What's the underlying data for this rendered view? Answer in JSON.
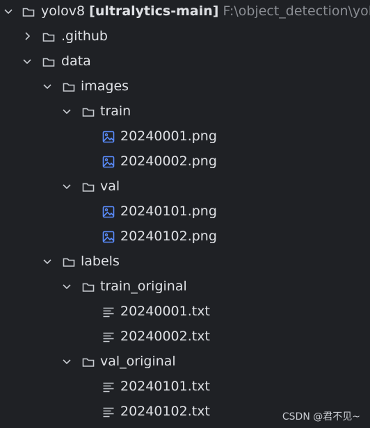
{
  "tree": {
    "root": {
      "name": "yolov8",
      "project": "[ultralytics-main]",
      "path": "F:\\object_detection\\yolo"
    },
    "items": [
      {
        "name": ".github",
        "kind": "folder",
        "state": "collapsed"
      },
      {
        "name": "data",
        "kind": "folder",
        "state": "expanded"
      },
      {
        "name": "images",
        "kind": "folder",
        "state": "expanded"
      },
      {
        "name": "train",
        "kind": "folder",
        "state": "expanded"
      },
      {
        "name": "20240001.png",
        "kind": "image-file"
      },
      {
        "name": "20240002.png",
        "kind": "image-file"
      },
      {
        "name": "val",
        "kind": "folder",
        "state": "expanded"
      },
      {
        "name": "20240101.png",
        "kind": "image-file"
      },
      {
        "name": "20240102.png",
        "kind": "image-file"
      },
      {
        "name": "labels",
        "kind": "folder",
        "state": "expanded"
      },
      {
        "name": "train_original",
        "kind": "folder",
        "state": "expanded"
      },
      {
        "name": "20240001.txt",
        "kind": "text-file"
      },
      {
        "name": "20240002.txt",
        "kind": "text-file"
      },
      {
        "name": "val_original",
        "kind": "folder",
        "state": "expanded"
      },
      {
        "name": "20240101.txt",
        "kind": "text-file"
      },
      {
        "name": "20240102.txt",
        "kind": "text-file"
      }
    ]
  },
  "watermark": "CSDN @君不见~",
  "colors": {
    "background": "#1f2125",
    "text": "#dfe1e5",
    "path_text": "#8b8e94",
    "image_icon": "#5a8dff",
    "icon_stroke": "#c8ccd2"
  },
  "icons": {
    "chevron_down": "chevron-down-icon",
    "chevron_right": "chevron-right-icon",
    "folder": "folder-icon",
    "image_file": "image-file-icon",
    "text_file": "text-file-icon"
  }
}
